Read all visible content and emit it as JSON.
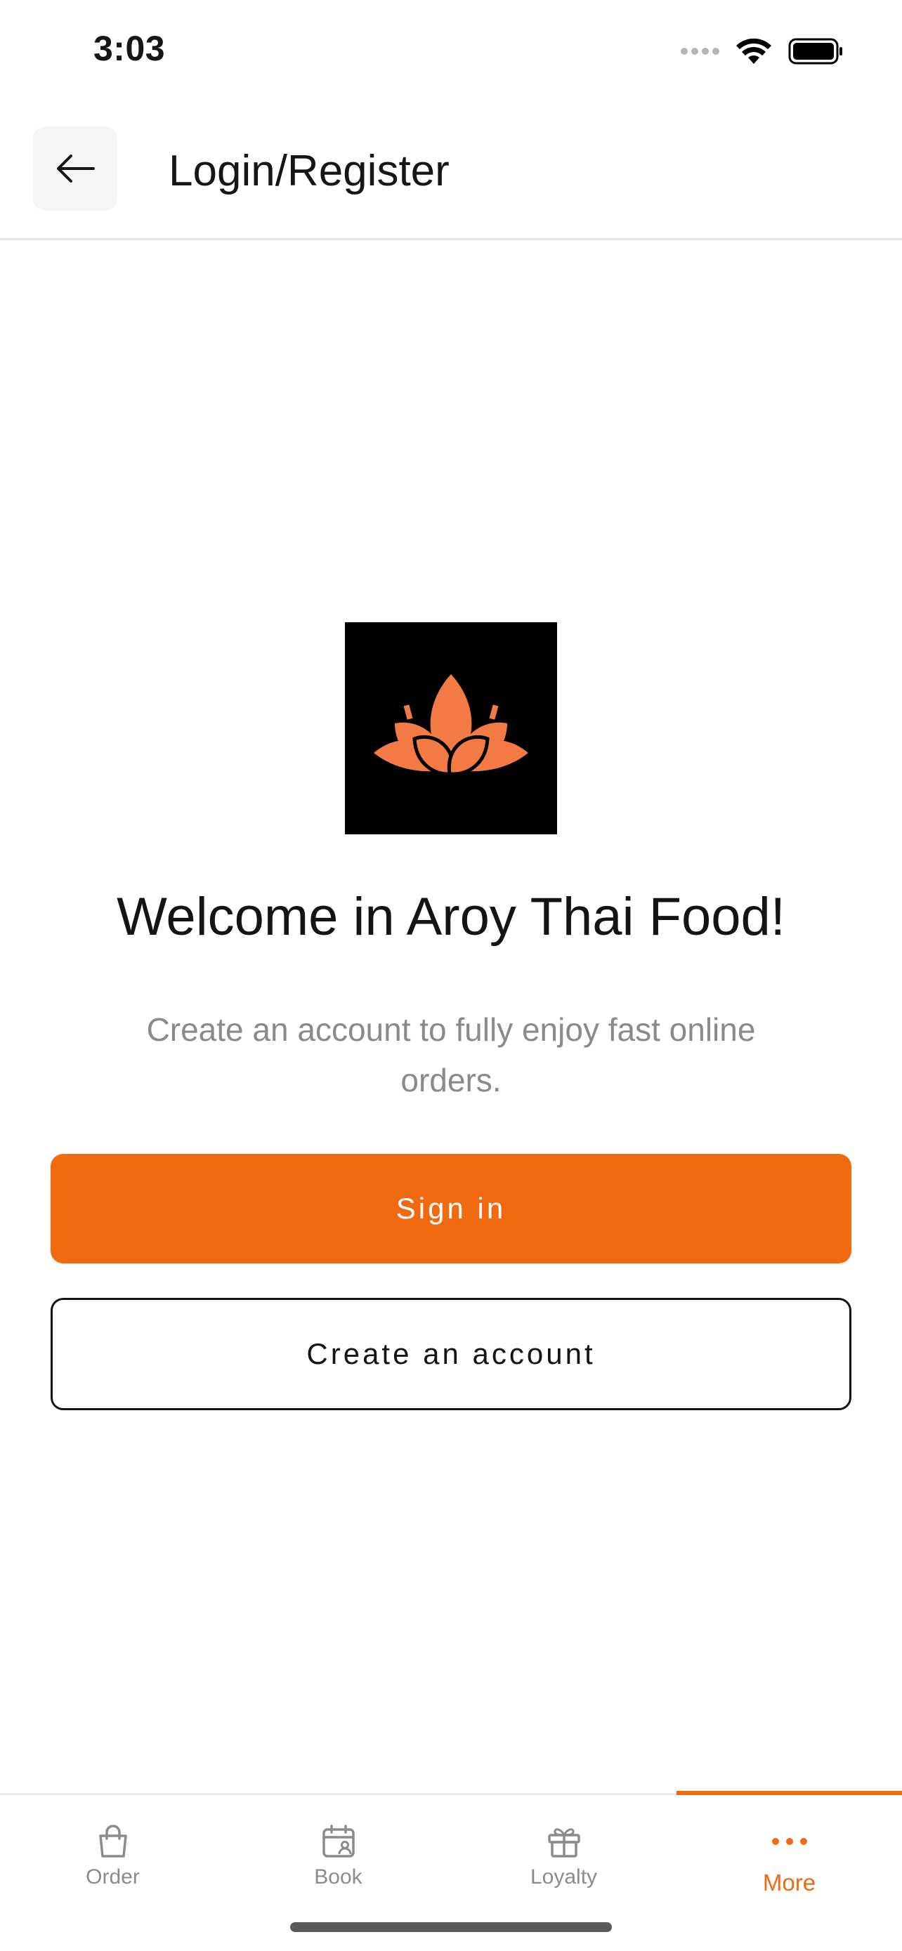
{
  "status_bar": {
    "time": "3:03",
    "icons": [
      "signal-icon",
      "wifi-icon",
      "battery-icon"
    ]
  },
  "header": {
    "back_icon": "arrow-left-icon",
    "title": "Login/Register"
  },
  "main": {
    "logo_icon": "lotus-logo-icon",
    "welcome_title": "Welcome in Aroy Thai Food!",
    "subtitle": "Create an account to fully enjoy fast online orders.",
    "sign_in_label": "Sign in",
    "create_account_label": "Create an account"
  },
  "bottom_nav": {
    "items": [
      {
        "label": "Order",
        "icon": "shopping-bag-icon",
        "active": false
      },
      {
        "label": "Book",
        "icon": "calendar-user-icon",
        "active": false
      },
      {
        "label": "Loyalty",
        "icon": "gift-icon",
        "active": false
      },
      {
        "label": "More",
        "icon": "more-dots-icon",
        "active": true
      }
    ]
  },
  "colors": {
    "accent": "#f26a0f",
    "logo_petal": "#f47a45",
    "logo_background": "#000000",
    "text_primary": "#161616",
    "text_secondary": "#8a8a8a"
  }
}
